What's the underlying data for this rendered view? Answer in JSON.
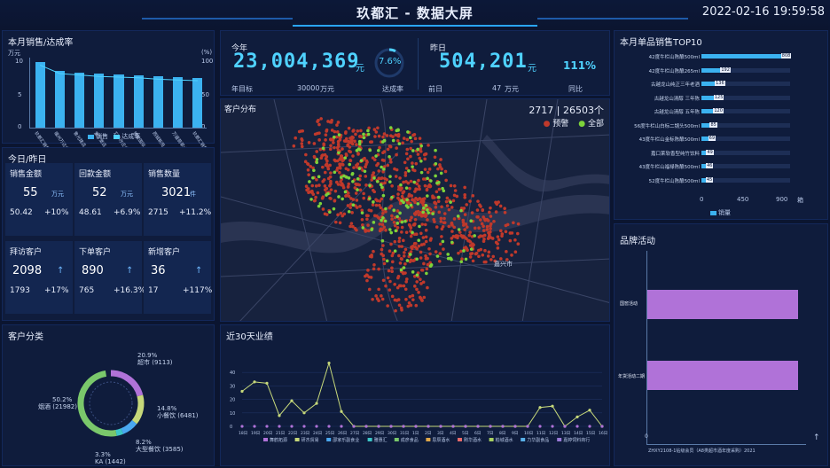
{
  "header": {
    "title": "玖都汇 - 数据大屏",
    "datetime": "2022-02-16 19:59:58"
  },
  "sales": {
    "title": "本月销售/达成率",
    "left_unit": "万元",
    "right_unit": "(%)",
    "yticks_left": [
      "10",
      "5",
      "0"
    ],
    "yticks_right": [
      "100",
      "50",
      "0"
    ],
    "legend": [
      "销售",
      "达成率"
    ],
    "colors": {
      "bar": "#3bb2f0",
      "line": "#4fd2ff"
    },
    "bars": [
      {
        "label": "玖都汇销售",
        "value": 0.92
      },
      {
        "label": "福州万达店",
        "value": 0.8
      },
      {
        "label": "鲁光路店",
        "value": 0.78
      },
      {
        "label": "爱丁堡店",
        "value": 0.76
      },
      {
        "label": "汇丰亦庄店",
        "value": 0.75
      },
      {
        "label": "博爱国际",
        "value": 0.74
      },
      {
        "label": "西城新苑",
        "value": 0.72
      },
      {
        "label": "万盛翡翠山庄",
        "value": 0.71
      },
      {
        "label": "玖都汇销售中心",
        "value": 0.7
      }
    ]
  },
  "kpi": {
    "this_year_label": "今年",
    "this_year_value": "23,004,369",
    "this_year_unit": "元",
    "rate": "7.6%",
    "annual_target_label": "年目标",
    "annual_target": "30000",
    "annual_target_unit": "万元",
    "achieve_label": "达成率",
    "last_year_label": "昨日",
    "last_year_value": "504,201",
    "last_year_unit": "元",
    "growth": "111%",
    "prev_label": "前日",
    "prev_value": "47",
    "prev_unit": "万元",
    "yoy_label": "同比"
  },
  "today": {
    "title": "今日/昨日",
    "cards": [
      {
        "label": "销售金额",
        "value": "55",
        "unit": "万元",
        "yesterday": "50.42",
        "pct": "+10%"
      },
      {
        "label": "回款金额",
        "value": "52",
        "unit": "万元",
        "yesterday": "48.61",
        "pct": "+6.9%"
      },
      {
        "label": "销售数量",
        "value": "3021",
        "unit": "件",
        "yesterday": "2715",
        "pct": "+11.2%"
      },
      {
        "label": "拜访客户",
        "value": "2098",
        "unit": "↑",
        "yesterday": "1793",
        "pct": "+17%"
      },
      {
        "label": "下单客户",
        "value": "890",
        "unit": "↑",
        "yesterday": "765",
        "pct": "+16.3%"
      },
      {
        "label": "新增客户",
        "value": "36",
        "unit": "↑",
        "yesterday": "17",
        "pct": "+117%"
      }
    ]
  },
  "map": {
    "title": "客户分布",
    "count": "2717 | 26503个",
    "legend_warning": "预警",
    "legend_all": "全部",
    "colors": {
      "warning": "#c0392b",
      "all": "#7cd33a",
      "bg": "#17223e",
      "water": "#2a3452"
    }
  },
  "top10": {
    "title": "本月单品销售TOP10",
    "unit": "箱",
    "ticks": [
      "0",
      "450",
      "900"
    ],
    "legend": "销量",
    "items": [
      {
        "name": "42度牛栏山陈酿500ml",
        "value": 808
      },
      {
        "name": "42度牛栏山陈酿265ml",
        "value": 192
      },
      {
        "name": "古越龙山纯正三年老酒",
        "value": 136
      },
      {
        "name": "古越龙山清醇 三年陈",
        "value": 125
      },
      {
        "name": "古越龙山清醇 五年陈",
        "value": 120
      },
      {
        "name": "56度牛栏山白标二锅头500ml",
        "value": 85
      },
      {
        "name": "43度牛栏山金标陈酿500ml",
        "value": 69
      },
      {
        "name": "嘉口莱软香型纯竹饮料",
        "value": 49
      },
      {
        "name": "43度牛栏山福禄陈酿500ml",
        "value": 46
      },
      {
        "name": "52度牛栏山陈酿500ml",
        "value": 45
      }
    ]
  },
  "customers": {
    "title": "客户分类",
    "segments": [
      {
        "pct": "20.9%",
        "name": "超市 (9113)",
        "color": "#b072d8"
      },
      {
        "pct": "14.8%",
        "name": "小餐饮 (6481)",
        "color": "#c6d87a"
      },
      {
        "pct": "8.2%",
        "name": "大型餐饮 (3585)",
        "color": "#4aa8f0"
      },
      {
        "pct": "3.3%",
        "name": "KA (1442)",
        "color": "#3cc6c8"
      },
      {
        "pct": "50.2%",
        "name": "烟酒 (21982)",
        "color": "#7ac86b"
      }
    ]
  },
  "trend": {
    "title": "近30天业绩",
    "yticks": [
      "40",
      "30",
      "20",
      "10",
      "0"
    ],
    "x": [
      "18日",
      "19日",
      "20日",
      "21日",
      "22日",
      "23日",
      "24日",
      "25日",
      "26日",
      "27日",
      "28日",
      "29日",
      "30日",
      "31日",
      "1日",
      "2日",
      "3日",
      "4日",
      "5日",
      "6日",
      "7日",
      "8日",
      "9日",
      "10日",
      "11日",
      "12日",
      "13日",
      "14日",
      "15日",
      "16日"
    ],
    "values": [
      26,
      33,
      32,
      8,
      19,
      10,
      17,
      47,
      11,
      0,
      0,
      0,
      0,
      0,
      0,
      0,
      0,
      0,
      0,
      0,
      0,
      0,
      0,
      0,
      14,
      15,
      0,
      7,
      12,
      0
    ],
    "legend": [
      "舞鹤拓源",
      "研杰贸易",
      "邵家乐副食业",
      "雅惠汇",
      "成彦食品",
      "思辰酒水",
      "刚华酒水",
      "柏城酒水",
      "力华副食品",
      "嘉婷饲料商行"
    ]
  },
  "brand": {
    "title": "品牌活动",
    "bars": [
      {
        "label": "国窖活动",
        "value": 1.0
      },
      {
        "label": "年货活动二期",
        "value": 1.0
      }
    ],
    "footer": "ZHXY2108-1钻级会员（A8类超市酒年度采购）2021",
    "page_up": "↑"
  }
}
